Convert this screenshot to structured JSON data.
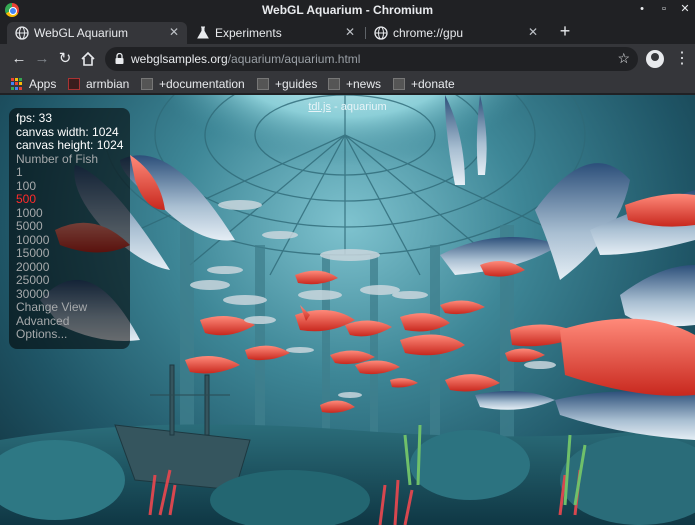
{
  "window": {
    "title": "WebGL Aquarium - Chromium"
  },
  "tabs": [
    {
      "label": "WebGL Aquarium",
      "icon": "globe-icon",
      "active": true
    },
    {
      "label": "Experiments",
      "icon": "flask-icon",
      "active": false
    },
    {
      "label": "chrome://gpu",
      "icon": "globe-icon",
      "active": false
    }
  ],
  "toolbar": {
    "url_host": "webglsamples.org",
    "url_path": "/aquarium/aquarium.html"
  },
  "bookmarks": [
    {
      "label": "Apps",
      "icon": "apps-grid-icon"
    },
    {
      "label": "armbian",
      "icon": "armbian-favicon"
    },
    {
      "label": "+documentation",
      "icon": "page-favicon"
    },
    {
      "label": "+guides",
      "icon": "page-favicon"
    },
    {
      "label": "+news",
      "icon": "page-favicon"
    },
    {
      "label": "+donate",
      "icon": "page-favicon"
    }
  ],
  "page": {
    "top_link": "tdl.js",
    "top_title": " - aquarium"
  },
  "overlay": {
    "fps": "fps: 33",
    "canvas_width": "canvas width: 1024",
    "canvas_height": "canvas height: 1024",
    "fish_heading": "Number of Fish",
    "fish_options": [
      "1",
      "100",
      "500",
      "1000",
      "5000",
      "10000",
      "15000",
      "20000",
      "25000",
      "30000"
    ],
    "selected_fish": "500",
    "change_view": "Change View",
    "advanced": "Advanced",
    "options": "Options..."
  },
  "colors": {
    "selected_option": "#ff2a2a",
    "option_text": "#a6a9ab",
    "tab_active_bg": "#35363a",
    "frame_bg": "#202124"
  }
}
